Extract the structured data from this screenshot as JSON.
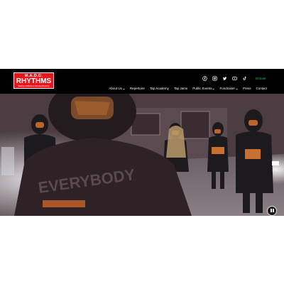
{
  "logo": {
    "line1": "M.A.D.D.",
    "line2": "RHYTHMS",
    "line3": "Making a Difference Dancing Rhythms"
  },
  "social": {
    "icons": [
      "facebook-icon",
      "instagram-icon",
      "twitter-icon",
      "youtube-icon",
      "tiktok-icon"
    ]
  },
  "donate_label": "Donate",
  "nav": {
    "items": [
      {
        "label": "About Us",
        "dropdown": true
      },
      {
        "label": "Repertoire",
        "dropdown": false
      },
      {
        "label": "Tap Academy",
        "dropdown": false
      },
      {
        "label": "Tap Jams",
        "dropdown": false
      },
      {
        "label": "Public Events",
        "dropdown": true
      },
      {
        "label": "Fundraiser",
        "dropdown": true
      },
      {
        "label": "Press",
        "dropdown": false
      },
      {
        "label": "Contact",
        "dropdown": false
      }
    ]
  },
  "video": {
    "shirt_text": "EVERYBODY"
  },
  "colors": {
    "brand_red": "#e8151b",
    "donate_green": "#39b54a",
    "header_bg": "#000000"
  }
}
